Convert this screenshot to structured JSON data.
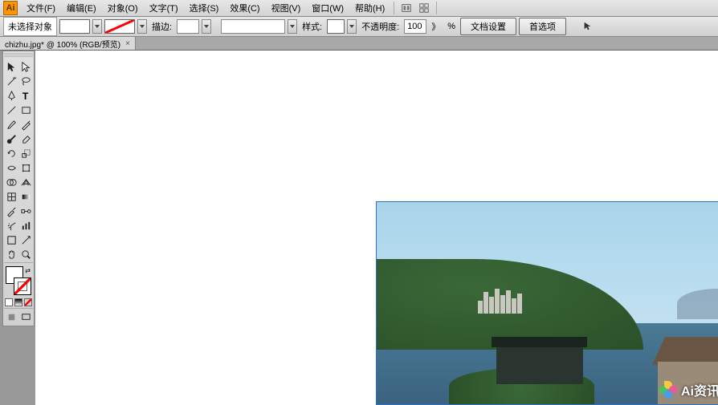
{
  "app": {
    "icon_letter": "Ai"
  },
  "menu": {
    "items": [
      "文件(F)",
      "编辑(E)",
      "对象(O)",
      "文字(T)",
      "选择(S)",
      "效果(C)",
      "视图(V)",
      "窗口(W)",
      "帮助(H)"
    ]
  },
  "options": {
    "selection_label": "未选择对象",
    "stroke_label": "描边:",
    "style_label": "样式:",
    "opacity_label": "不透明度:",
    "opacity_value": "100",
    "opacity_arrow": "》",
    "percent": "%",
    "doc_setup_btn": "文档设置",
    "prefs_btn": "首选项"
  },
  "tab": {
    "label": "chizhu.jpg* @ 100% (RGB/预览)",
    "close": "×"
  },
  "watermark": {
    "text": "Ai资讯网"
  },
  "tools": {
    "names": [
      [
        "selection-tool",
        "direct-selection-tool"
      ],
      [
        "magic-wand-tool",
        "lasso-tool"
      ],
      [
        "pen-tool",
        "type-tool"
      ],
      [
        "line-tool",
        "rectangle-tool"
      ],
      [
        "paintbrush-tool",
        "pencil-tool"
      ],
      [
        "blob-brush-tool",
        "eraser-tool"
      ],
      [
        "rotate-tool",
        "scale-tool"
      ],
      [
        "width-tool",
        "free-transform-tool"
      ],
      [
        "shape-builder-tool",
        "perspective-grid-tool"
      ],
      [
        "mesh-tool",
        "gradient-tool"
      ],
      [
        "eyedropper-tool",
        "blend-tool"
      ],
      [
        "symbol-sprayer-tool",
        "column-graph-tool"
      ],
      [
        "artboard-tool",
        "slice-tool"
      ],
      [
        "hand-tool",
        "zoom-tool"
      ]
    ]
  }
}
